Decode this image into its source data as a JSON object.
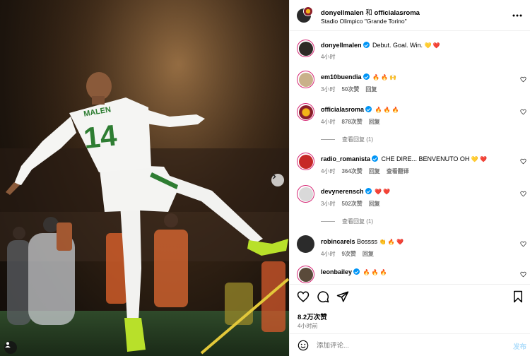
{
  "post": {
    "header": {
      "author": "donyellmalen",
      "conjunction": "和",
      "collaborator": "officialasroma",
      "location": "Stadio Olimpico \"Grande Torino\""
    },
    "caption": {
      "username": "donyellmalen",
      "text": "Debut. Goal. Win.",
      "emoji": "💛 ❤️",
      "time": "4小时"
    },
    "comments": [
      {
        "username": "em10buendia",
        "verified": true,
        "text": "",
        "emoji": "🔥 🔥 🙌",
        "time": "3小时",
        "likes": "50次赞",
        "reply": "回复",
        "extra": ""
      },
      {
        "username": "officialasroma",
        "verified": true,
        "text": "",
        "emoji": "🔥 🔥 🔥",
        "time": "4小时",
        "likes": "878次赞",
        "reply": "回复",
        "extra": "",
        "view_replies": "查看回复 (1)"
      },
      {
        "username": "radio_romanista",
        "verified": true,
        "text": "CHE DIRE... BENVENUTO OH",
        "emoji": "💛 ❤️",
        "time": "4小时",
        "likes": "364次赞",
        "reply": "回复",
        "extra": "查看翻译"
      },
      {
        "username": "devynerensch",
        "verified": true,
        "text": "",
        "emoji": "❤️ ❤️",
        "time": "3小时",
        "likes": "502次赞",
        "reply": "回复",
        "extra": "",
        "view_replies": "查看回复 (1)"
      },
      {
        "username": "robincarels",
        "verified": false,
        "text": "Bossss",
        "emoji": "👏 🔥 ❤️",
        "time": "4小时",
        "likes": "9次赞",
        "reply": "回复",
        "extra": ""
      },
      {
        "username": "leonbailey",
        "verified": true,
        "text": "",
        "emoji": "🔥 🔥 🔥",
        "time": "",
        "likes": "",
        "reply": "",
        "extra": ""
      }
    ],
    "likes_count": "8.2万次赞",
    "post_time": "4小时前",
    "composer": {
      "placeholder": "添加评论...",
      "post_label": "发布"
    },
    "media": {
      "jersey_name": "MALEN",
      "jersey_number": "14"
    }
  },
  "icons": {
    "more": "more-options-icon",
    "like": "heart-icon",
    "comment": "comment-icon",
    "share": "share-icon",
    "save": "bookmark-icon",
    "emoji": "emoji-icon",
    "next": "chevron-right-icon",
    "tag": "user-tag-icon"
  },
  "colors": {
    "accent": "#0095f6",
    "muted": "#737373",
    "post_button": "#b2dffc",
    "kit_green": "#2e7d32"
  }
}
